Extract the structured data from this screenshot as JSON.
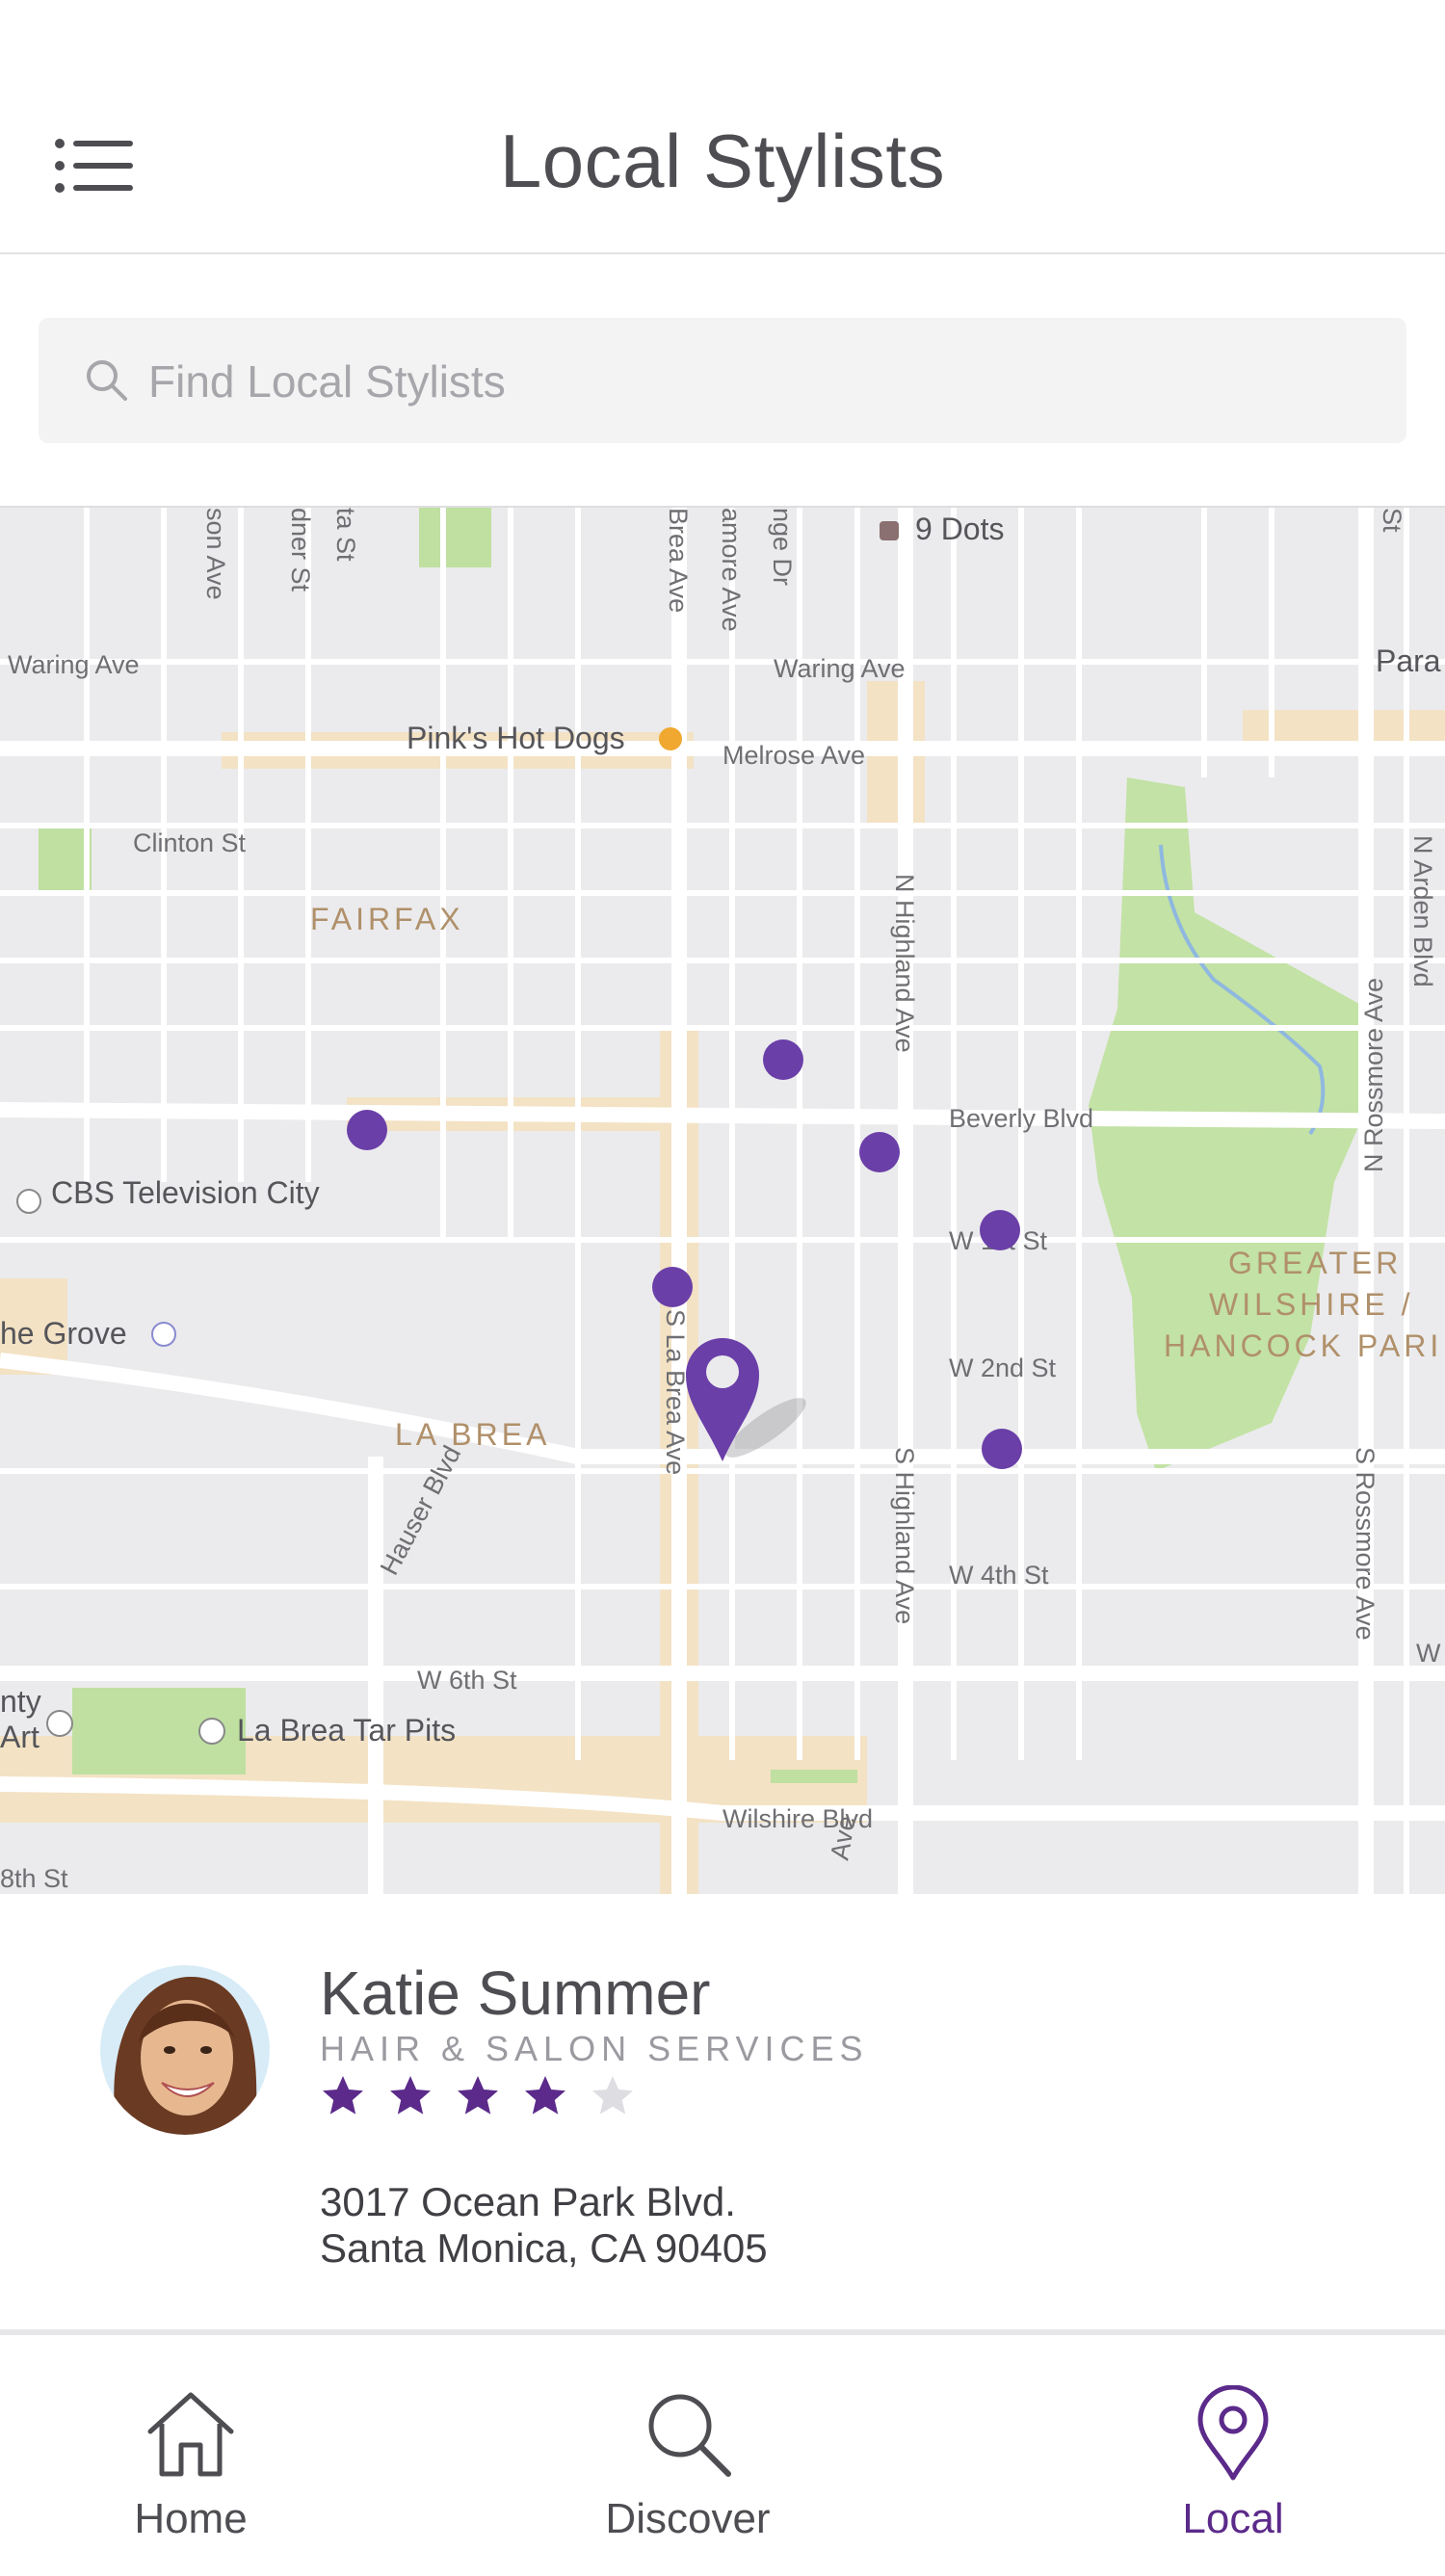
{
  "header": {
    "title": "Local Stylists",
    "menu_icon": "list-menu-icon"
  },
  "search": {
    "placeholder": "Find Local Stylists",
    "value": "",
    "icon": "search-icon"
  },
  "map": {
    "labels": {
      "nine_dots": "9 Dots",
      "pinks": "Pink's Hot Dogs",
      "fairfax": "FAIRFAX",
      "cbs": "CBS Television City",
      "grove": "he Grove",
      "la_brea": "LA BREA",
      "tar_pits": "La Brea Tar Pits",
      "greater_1": "GREATER",
      "greater_2": "WILSHIRE /",
      "greater_3": "HANCOCK PARI",
      "para": "Para",
      "art_1": "nty",
      "art_2": "Art"
    },
    "streets": {
      "waring_left": "Waring Ave",
      "waring_mid": "Waring Ave",
      "melrose": "Melrose Ave",
      "clinton": "Clinton St",
      "beverly": "Beverly Blvd",
      "w1st": "W 1st St",
      "w2nd": "W 2nd St",
      "w4th": "W 4th St",
      "w6th": "W 6th St",
      "wilshire": "Wilshire Blvd",
      "eighth": "8th St",
      "w_edge": "W",
      "n_highland": "N Highland Ave",
      "s_highland": "S Highland Ave",
      "n_rossmore": "N Rossmore Ave",
      "s_rossmore": "S Rossmore Ave",
      "n_arden": "N Arden Blvd",
      "s_la_brea": "S La Brea Ave",
      "hauser": "Hauser Blvd",
      "brea_ave": "Brea Ave",
      "ne_dr": "nge Dr",
      "camore": "amore Ave",
      "son": "son Ave",
      "ta_st": "ta St",
      "dner": "dner St",
      "ave_bottom": "Ave",
      "st_top": "St"
    },
    "accent_color": "#6a3fa8"
  },
  "stylist": {
    "name": "Katie Summer",
    "category": "HAIR & SALON SERVICES",
    "rating": 4,
    "rating_max": 5,
    "address_line1": "3017 Ocean Park Blvd.",
    "address_line2": "Santa Monica, CA 90405"
  },
  "nav": {
    "items": [
      {
        "label": "Home",
        "icon": "home-icon",
        "active": false
      },
      {
        "label": "Discover",
        "icon": "search-icon",
        "active": false
      },
      {
        "label": "Local",
        "icon": "location-pin-icon",
        "active": true
      }
    ],
    "active_color": "#5b2a8a",
    "inactive_color": "#4d4d52"
  }
}
